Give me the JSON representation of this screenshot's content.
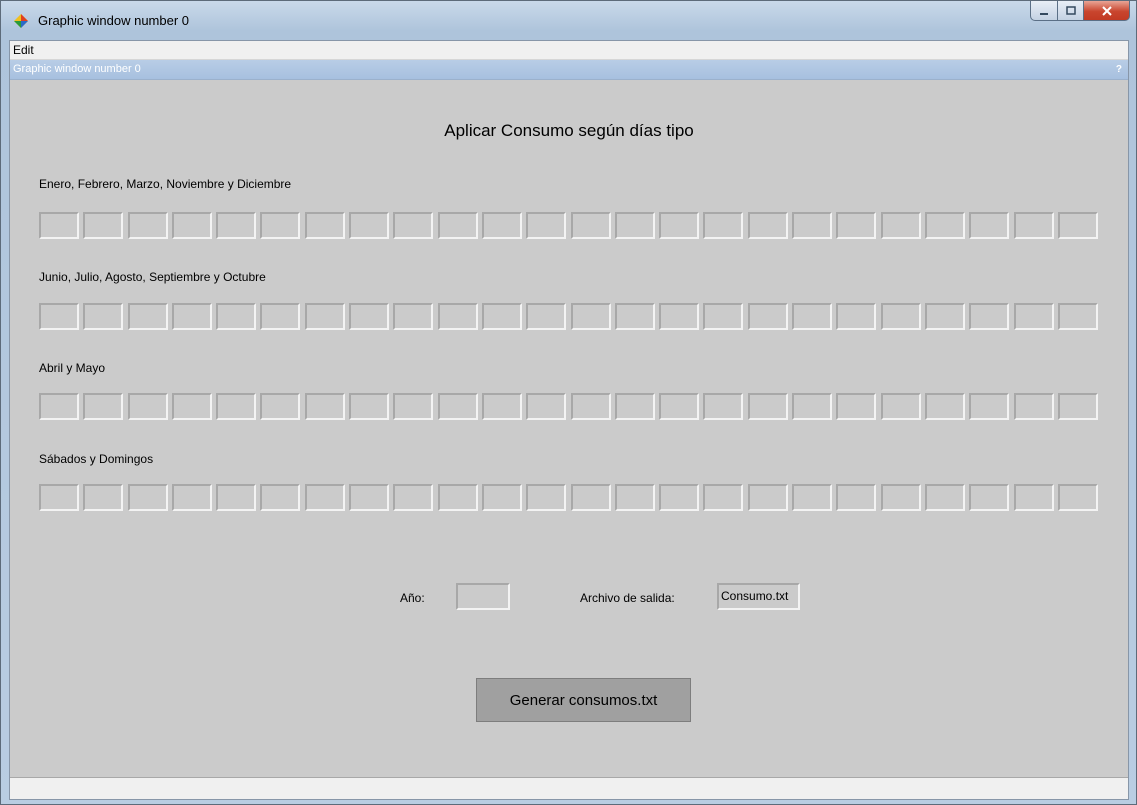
{
  "window": {
    "title": "Graphic window number 0"
  },
  "menu": {
    "items": [
      "Edit"
    ]
  },
  "dock": {
    "title": "Graphic window number 0",
    "help": "?"
  },
  "form": {
    "title": "Aplicar Consumo según días tipo",
    "sections": [
      {
        "label": "Enero, Febrero, Marzo, Noviembre y Diciembre",
        "cells": 24
      },
      {
        "label": "Junio, Julio, Agosto, Septiembre y Octubre",
        "cells": 24
      },
      {
        "label": "Abril y Mayo",
        "cells": 24
      },
      {
        "label": "Sábados y Domingos",
        "cells": 24
      }
    ],
    "year_label": "Año:",
    "year_value": "",
    "output_label": "Archivo de salida:",
    "output_value": "Consumo.txt",
    "generate_button": "Generar consumos.txt"
  }
}
